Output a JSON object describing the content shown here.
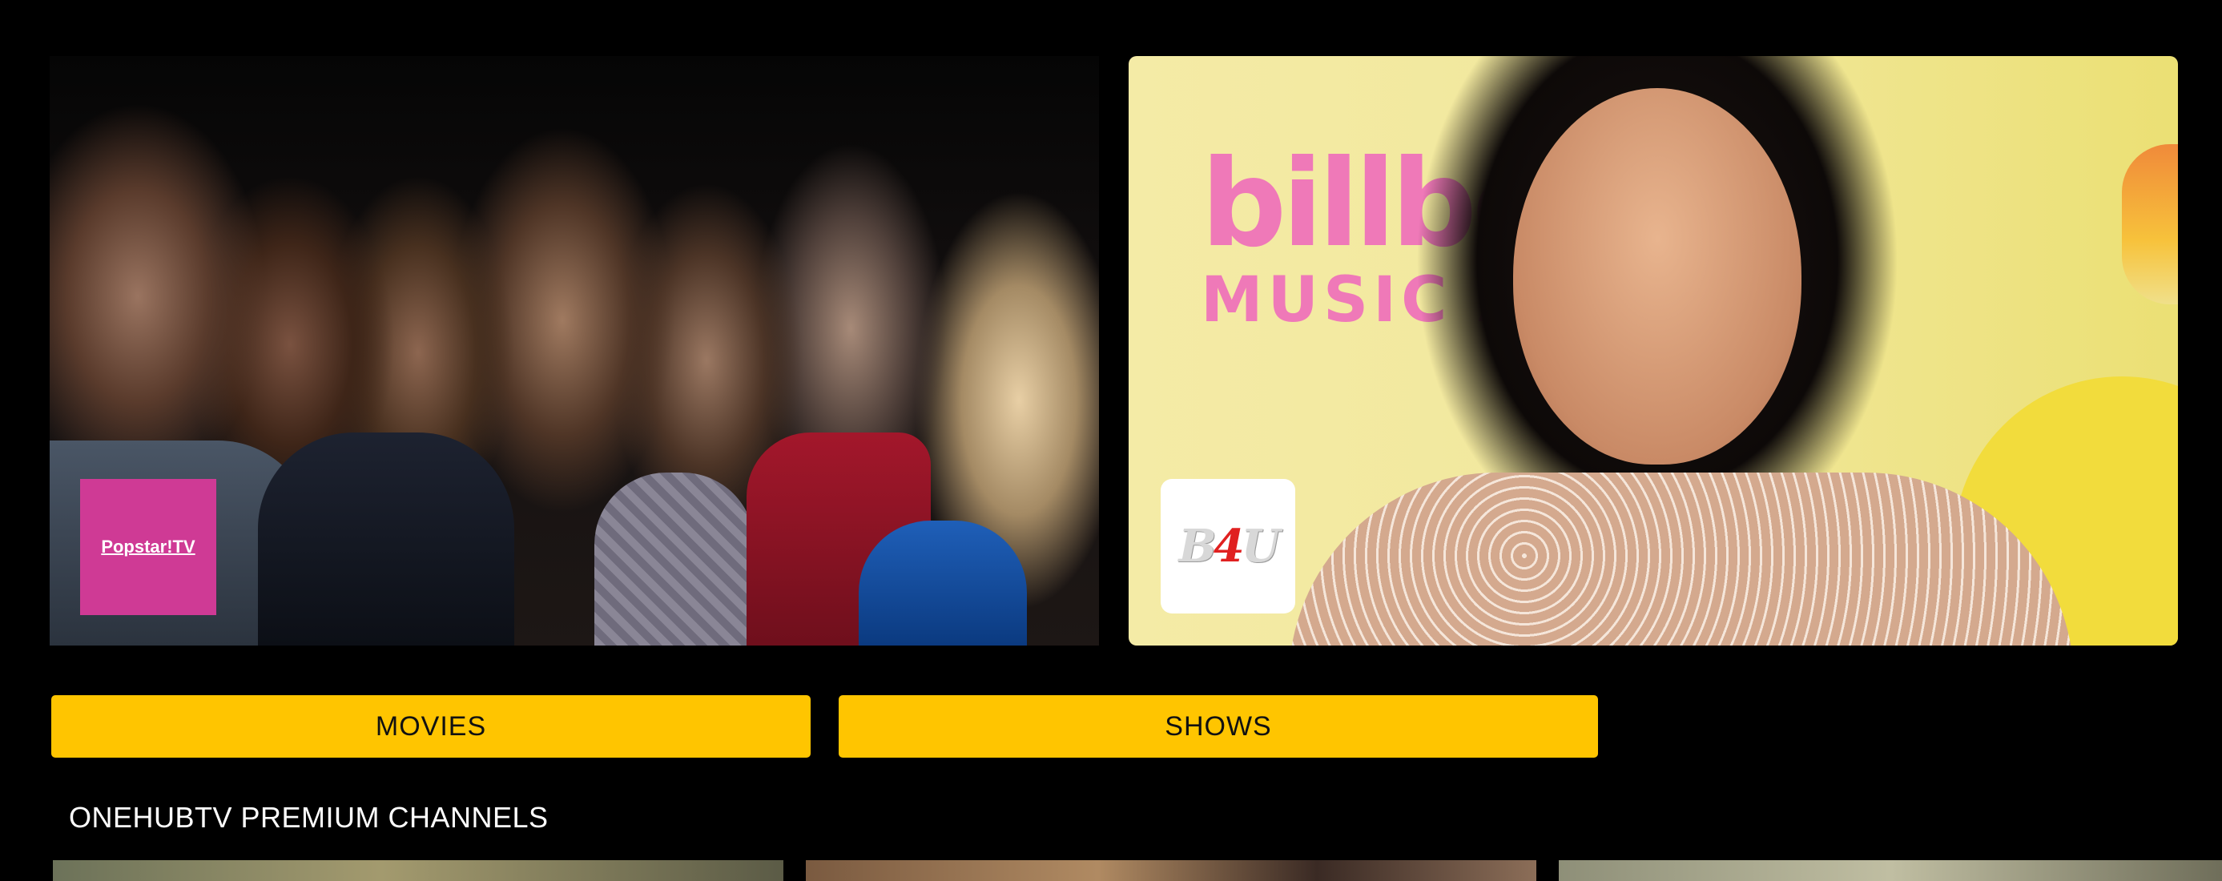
{
  "hero": {
    "left_banner": {
      "channel_logo": {
        "label": "Popstar!TV",
        "color": "#cf3a95"
      }
    },
    "right_banner": {
      "background_text_line1": "billbo",
      "background_text_line2": "MUSIC A",
      "channel_logo": {
        "label_b": "B",
        "label_4": "4",
        "label_u": "U"
      }
    }
  },
  "nav_buttons": {
    "movies": "MOVIES",
    "shows": "SHOWS",
    "color": "#ffc500"
  },
  "section": {
    "title": "ONEHUBTV PREMIUM CHANNELS"
  }
}
